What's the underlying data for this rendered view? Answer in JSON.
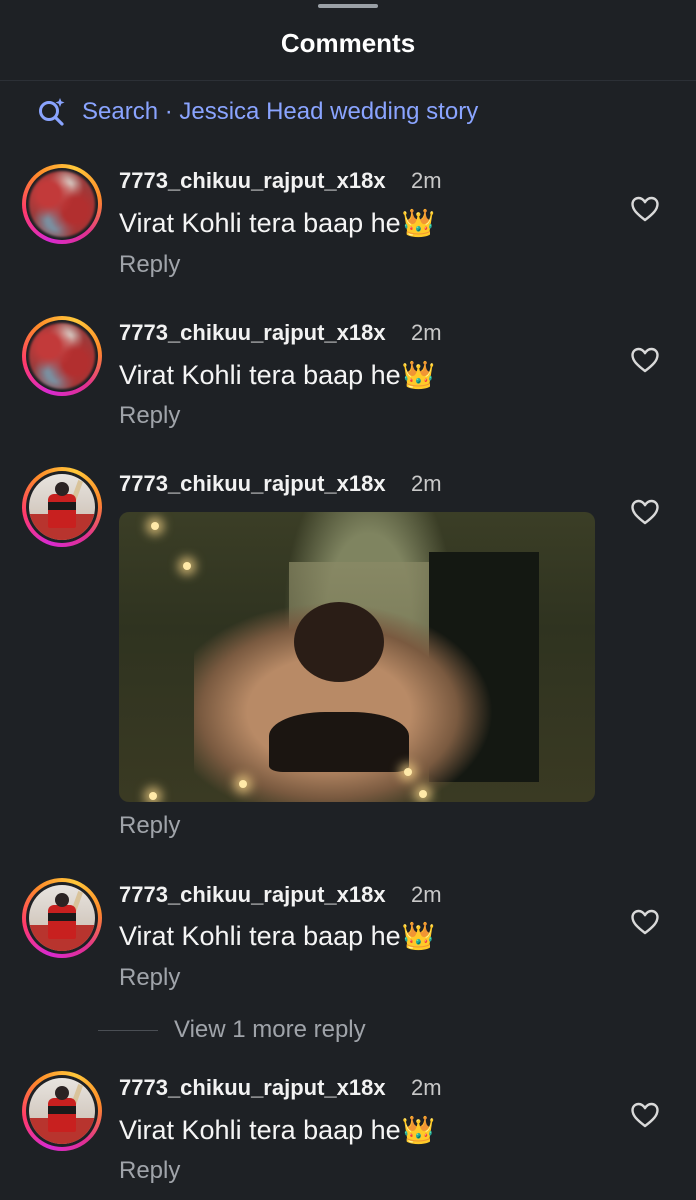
{
  "sheet": {
    "title": "Comments"
  },
  "search": {
    "label": "Search · Jessica Head wedding story",
    "icon": "search-sparkle-icon",
    "color": "#8aa4ff"
  },
  "comments": [
    {
      "username": "7773_chikuu_rajput_x18x",
      "time": "2m",
      "text": "Virat Kohli tera baap he",
      "emoji": "👑",
      "reply": "Reply",
      "like_icon": "heart-outline-icon"
    },
    {
      "username": "7773_chikuu_rajput_x18x",
      "time": "2m",
      "text": "Virat Kohli tera baap he",
      "emoji": "👑",
      "reply": "Reply",
      "like_icon": "heart-outline-icon"
    },
    {
      "username": "7773_chikuu_rajput_x18x",
      "time": "2m",
      "attachment": "gif",
      "reply": "Reply",
      "like_icon": "heart-outline-icon"
    },
    {
      "username": "7773_chikuu_rajput_x18x",
      "time": "2m",
      "text": "Virat Kohli tera baap he",
      "emoji": "👑",
      "reply": "Reply",
      "like_icon": "heart-outline-icon"
    },
    {
      "username": "7773_chikuu_rajput_x18x",
      "time": "2m",
      "text": "Virat Kohli tera baap he",
      "emoji": "👑",
      "reply": "Reply",
      "like_icon": "heart-outline-icon"
    }
  ],
  "view_more": {
    "label": "View 1 more reply"
  }
}
